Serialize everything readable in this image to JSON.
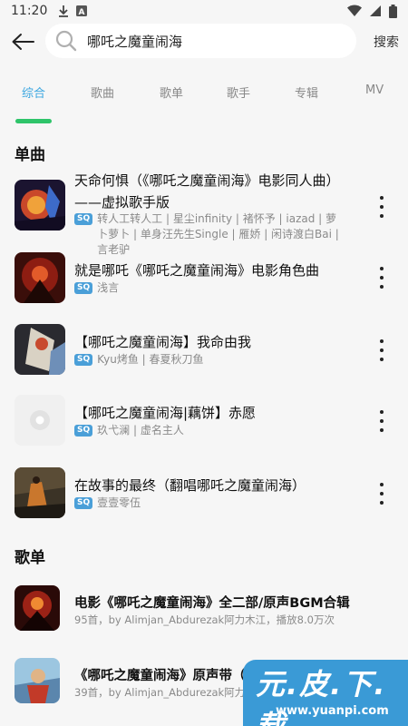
{
  "status_bar": {
    "time": "11:20",
    "icons": [
      "download-icon",
      "a-icon",
      "wifi-icon",
      "signal-icon",
      "battery-icon"
    ]
  },
  "search": {
    "query": "哪吒之魔童闹海",
    "submit_label": "搜索"
  },
  "tabs": [
    {
      "label": "综合",
      "active": true
    },
    {
      "label": "歌曲",
      "active": false
    },
    {
      "label": "歌单",
      "active": false
    },
    {
      "label": "歌手",
      "active": false
    },
    {
      "label": "专辑",
      "active": false
    },
    {
      "label": "MV",
      "active": false
    }
  ],
  "sections": {
    "songs_title": "单曲",
    "playlists_title": "歌单"
  },
  "badge": "SQ",
  "songs": [
    {
      "title": "天命何惧（《哪吒之魔童闹海》电影同人曲）——虚拟歌手版",
      "artists": "转人工转人工 | 星尘infinity | 褚怀予 | iazad | 萝卜萝卜 | 单身汪先生Single | 雁娇 | 闲诗渡白Bai | 言老驴"
    },
    {
      "title": "就是哪吒《哪吒之魔童闹海》电影角色曲",
      "artists": "浅言"
    },
    {
      "title": "【哪吒之魔童闹海】我命由我",
      "artists": "Kyu烤鱼 | 春夏秋刀鱼"
    },
    {
      "title": "【哪吒之魔童闹海|藕饼】赤愿",
      "artists": "玖弋澜 | 虚名主人"
    },
    {
      "title": "在故事的最终（翻唱哪吒之魔童闹海）",
      "artists": "壹壹零伍"
    }
  ],
  "playlists": [
    {
      "title": "电影《哪吒之魔童闹海》全二部/原声BGM合辑",
      "meta": "95首，by Alimjan_Abdurezak阿力木江，播放8.0万次"
    },
    {
      "title": "《哪吒之魔童闹海》原声带（全二部）",
      "meta": "39首，by Alimjan_Abdurezak阿力木江，播放"
    }
  ],
  "watermark": {
    "title": "元.皮.下.载",
    "url": "www.yuanpi.com"
  },
  "colors": {
    "accent_blue": "#3aa6e0",
    "indicator_green": "#2fc46a",
    "badge_blue": "#4a9fd8",
    "watermark_blue": "#3a9ad6"
  }
}
